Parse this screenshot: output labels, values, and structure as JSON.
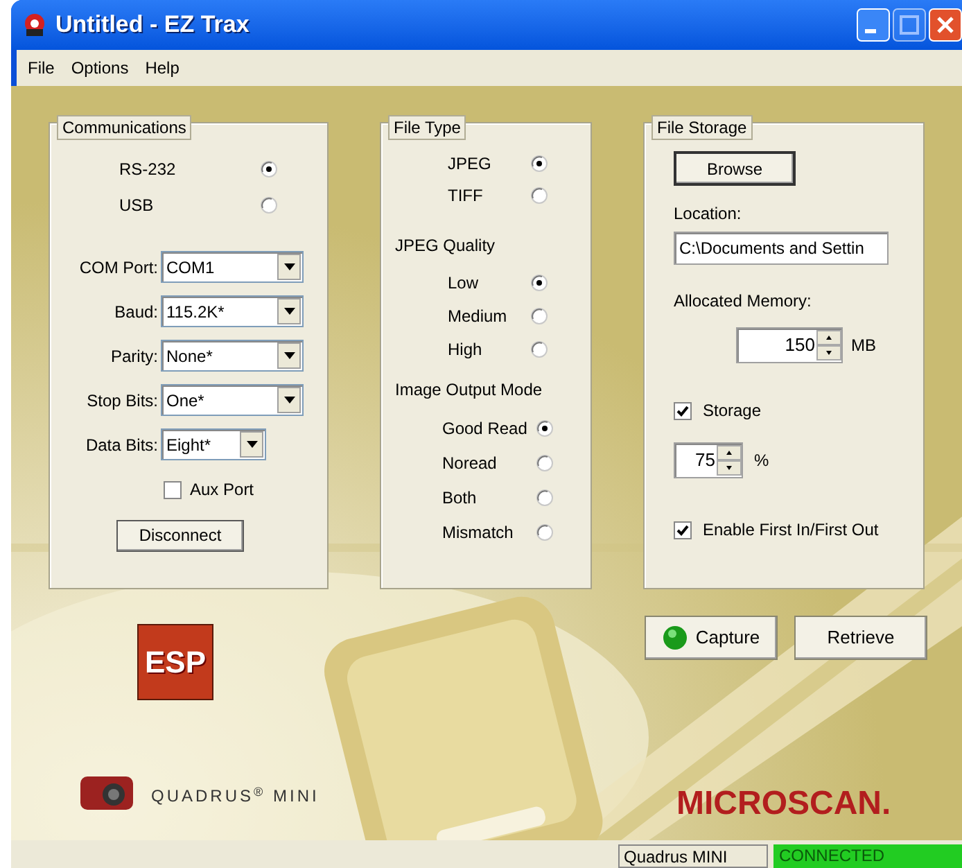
{
  "window": {
    "title": "Untitled - EZ Trax"
  },
  "menu": [
    "File",
    "Options",
    "Help"
  ],
  "communications": {
    "title": "Communications",
    "interfaces": [
      {
        "label": "RS-232",
        "selected": true
      },
      {
        "label": "USB",
        "selected": false
      }
    ],
    "settings": [
      {
        "label": "COM Port:",
        "value": "COM1"
      },
      {
        "label": "Baud:",
        "value": "115.2K*"
      },
      {
        "label": "Parity:",
        "value": "None*"
      },
      {
        "label": "Stop Bits:",
        "value": "One*"
      },
      {
        "label": "Data Bits:",
        "value": "Eight*"
      }
    ],
    "aux_port": {
      "label": "Aux Port",
      "checked": false
    },
    "button": "Disconnect"
  },
  "file_type": {
    "title": "File Type",
    "types": [
      {
        "label": "JPEG",
        "selected": true
      },
      {
        "label": "TIFF",
        "selected": false
      }
    ],
    "quality_title": "JPEG Quality",
    "qualities": [
      {
        "label": "Low",
        "selected": true
      },
      {
        "label": "Medium",
        "selected": false
      },
      {
        "label": "High",
        "selected": false
      }
    ],
    "output_title": "Image Output Mode",
    "modes": [
      {
        "label": "Good Read",
        "selected": true
      },
      {
        "label": "Noread",
        "selected": false
      },
      {
        "label": "Both",
        "selected": false
      },
      {
        "label": "Mismatch",
        "selected": false
      }
    ]
  },
  "file_storage": {
    "title": "File Storage",
    "browse": "Browse",
    "location_label": "Location:",
    "location": "C:\\Documents and Settin",
    "memory_label": "Allocated Memory:",
    "memory": "150",
    "memory_unit": "MB",
    "storage": {
      "label": "Storage",
      "checked": true
    },
    "percent": "75",
    "percent_unit": "%",
    "fifo": {
      "label": "Enable First In/First Out",
      "checked": true
    }
  },
  "actions": [
    {
      "label": "Capture",
      "kind": "indicator"
    },
    {
      "label": "Retrieve",
      "kind": "plain"
    }
  ],
  "logos": {
    "badge": "ESP",
    "product": "QUADRUS$^{®}$ MINI",
    "brand": "MICROSCAN."
  },
  "status_bar": [
    {
      "text": "Quadrus MINI",
      "kind": "plain"
    },
    {
      "text": "CONNECTED",
      "kind": "connected"
    }
  ]
}
